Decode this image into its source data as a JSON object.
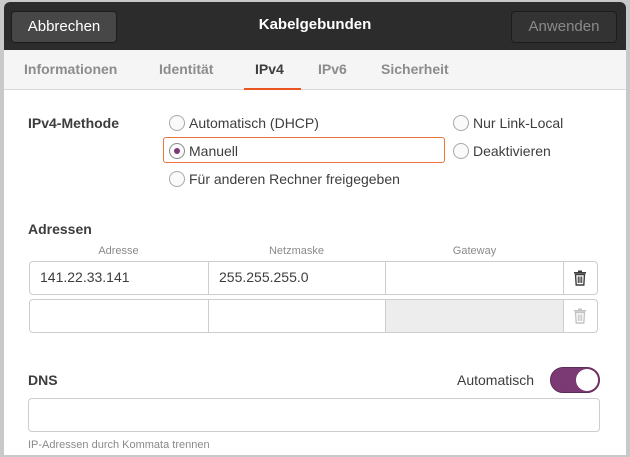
{
  "header": {
    "cancel_label": "Abbrechen",
    "title": "Kabelgebunden",
    "apply_label": "Anwenden"
  },
  "tabs": [
    {
      "label": "Informationen"
    },
    {
      "label": "Identität"
    },
    {
      "label": "IPv4",
      "active": true
    },
    {
      "label": "IPv6"
    },
    {
      "label": "Sicherheit"
    }
  ],
  "ipv4_method": {
    "label": "IPv4-Methode",
    "options": [
      {
        "label": "Automatisch (DHCP)",
        "checked": false
      },
      {
        "label": "Manuell",
        "checked": true
      },
      {
        "label": "Für anderen Rechner freigegeben",
        "checked": false
      },
      {
        "label": "Nur Link-Local",
        "checked": false
      },
      {
        "label": "Deaktivieren",
        "checked": false
      }
    ]
  },
  "addresses": {
    "label": "Adressen",
    "columns": [
      "Adresse",
      "Netzmaske",
      "Gateway"
    ],
    "rows": [
      {
        "address": "141.22.33.141",
        "netmask": "255.255.255.0",
        "gateway": ""
      },
      {
        "address": "",
        "netmask": "",
        "gateway": ""
      }
    ]
  },
  "dns": {
    "label": "DNS",
    "automatic_label": "Automatisch",
    "automatic": true,
    "value": "",
    "hint": "IP-Adressen durch Kommata trennen"
  },
  "colors": {
    "accent": "#e95420",
    "toggle": "#7b3a73",
    "headerbar": "#2c2c2c"
  }
}
